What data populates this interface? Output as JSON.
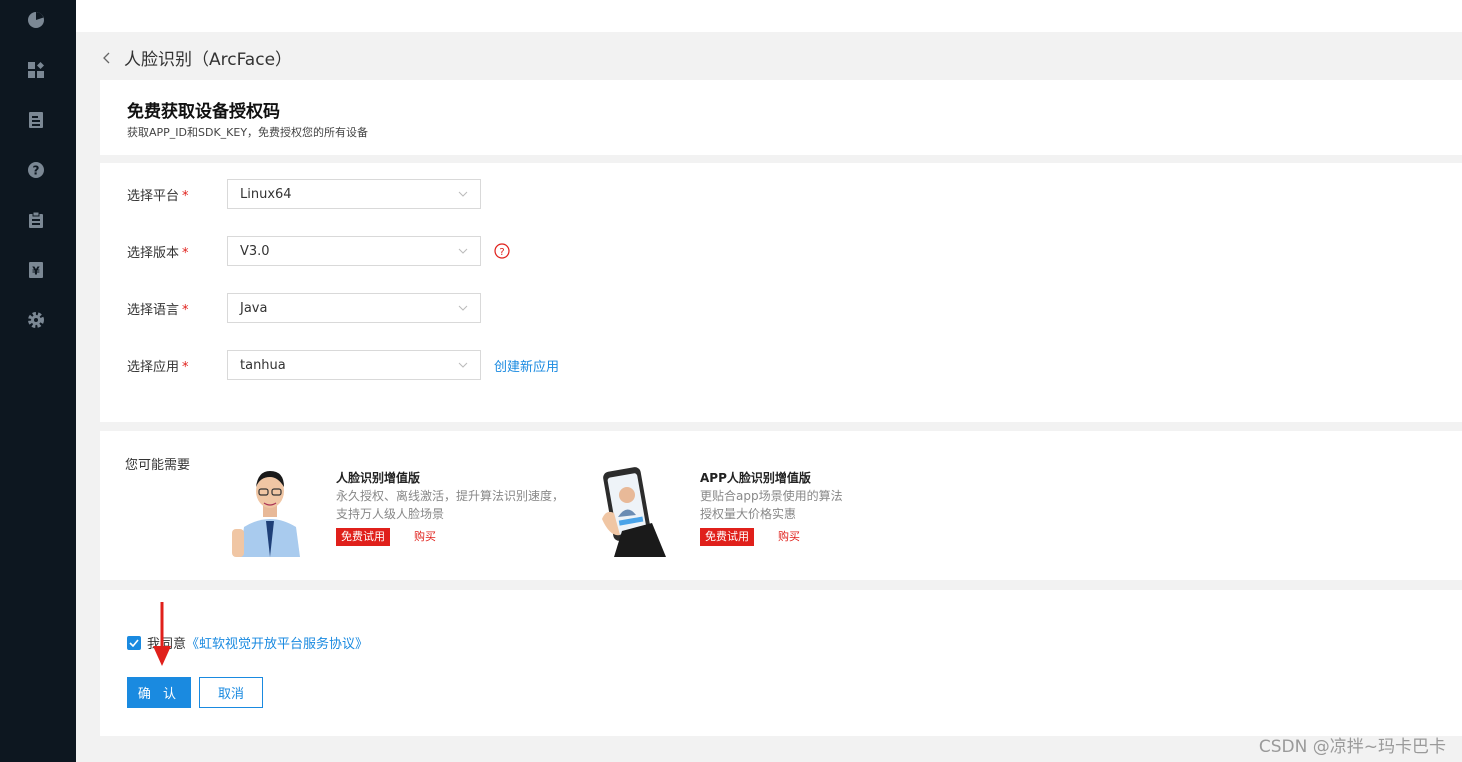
{
  "sidebar": {
    "icons": [
      "pie-chart-icon",
      "dashboard-icon",
      "document-icon",
      "help-icon",
      "clipboard-icon",
      "yen-icon",
      "gear-icon"
    ]
  },
  "breadcrumb": {
    "title": "人脸识别（ArcFace）"
  },
  "header": {
    "title": "免费获取设备授权码",
    "subtitle": "获取APP_ID和SDK_KEY，免费授权您的所有设备"
  },
  "form": {
    "platform": {
      "label": "选择平台",
      "required": "*",
      "value": "Linux64"
    },
    "version": {
      "label": "选择版本",
      "required": "*",
      "value": "V3.0"
    },
    "language": {
      "label": "选择语言",
      "required": "*",
      "value": "Java"
    },
    "app": {
      "label": "选择应用",
      "required": "*",
      "value": "tanhua",
      "create_link": "创建新应用"
    }
  },
  "recommend": {
    "label": "您可能需要",
    "products": [
      {
        "title": "人脸识别增值版",
        "desc1": "永久授权、离线激活，提升算法识别速度，",
        "desc2": "支持万人级人脸场景",
        "trial": "免费试用",
        "buy": "购买"
      },
      {
        "title": "APP人脸识别增值版",
        "desc1": "更贴合app场景使用的算法",
        "desc2": "授权量大价格实惠",
        "trial": "免费试用",
        "buy": "购买"
      }
    ]
  },
  "agreement": {
    "checked": true,
    "text": "我同意",
    "link": "《虹软视觉开放平台服务协议》"
  },
  "buttons": {
    "confirm": "确 认",
    "cancel": "取消"
  },
  "watermark": "CSDN @凉拌~玛卡巴卡",
  "colors": {
    "accent": "#1a8ae0",
    "danger": "#e0201b",
    "sidebar": "#0d1720"
  }
}
